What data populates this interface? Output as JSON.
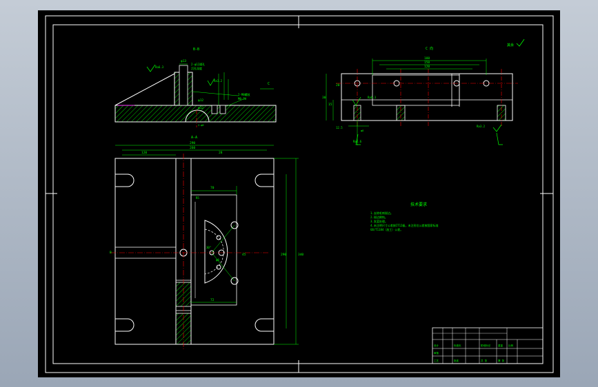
{
  "colors": {
    "background": "#000000",
    "viewport": "#a9b4c2",
    "outline": "#ffffff",
    "dimension": "#00ff00",
    "centerline": "#ff0000",
    "hatch": "#00ff00",
    "text": "#00ff00",
    "magenta": "#ff00ff"
  },
  "front_view": {
    "label": "B-B",
    "dims": {
      "d_top": "φ13",
      "d_mid": "φ12",
      "d_low": "φ12",
      "note_a": "2-φ12通孔",
      "note_b": "沉孔深度",
      "note_c": "2-M8螺纹",
      "note_d": "M8-7H",
      "roughness_left": "Ra6.3",
      "roughness_right": "Ra3.2",
      "arrow": "C"
    }
  },
  "side_view": {
    "label": "C 向",
    "dims": {
      "w1": "188",
      "w2": "150",
      "w3": "120",
      "h1": "20",
      "h2": "15",
      "h3": "30",
      "side_note": "12.5",
      "rough_a": "Ra6.3",
      "rough_b": "Ra3.2",
      "rough_c": "Ra1.6"
    }
  },
  "plan_view": {
    "label": "A-A",
    "dims": {
      "overall_w": "290",
      "inner_w": "260",
      "left_w": "120",
      "mid_w": "28",
      "top_off": "70",
      "bot_off": "72",
      "r": "R5",
      "h_overall": "340",
      "h_inner": "290",
      "radius_small": "45",
      "angle": "30°",
      "dia": "φ8",
      "label_b": "B"
    }
  },
  "notes": {
    "title": "技术要求",
    "lines": [
      "1.去除毛刺锐边。",
      "2.锐边倒钝。",
      "3.发蓝处理。",
      "4.未注明尺寸公差按IT12级，未注形位公差按国家标准",
      "  GB/T1184（加工）公差。"
    ]
  },
  "title_block": {
    "r1": [
      "",
      "",
      "",
      "",
      ""
    ],
    "r2": [
      "设计",
      "",
      "标准化",
      "",
      "阶段标记",
      "重量",
      "比例"
    ],
    "r3": [
      "审核",
      "",
      "",
      "",
      "",
      "",
      ""
    ],
    "r4": [
      "工艺",
      "",
      "批准",
      "",
      "共 张",
      "第 张",
      ""
    ]
  },
  "corner_note": "其余"
}
